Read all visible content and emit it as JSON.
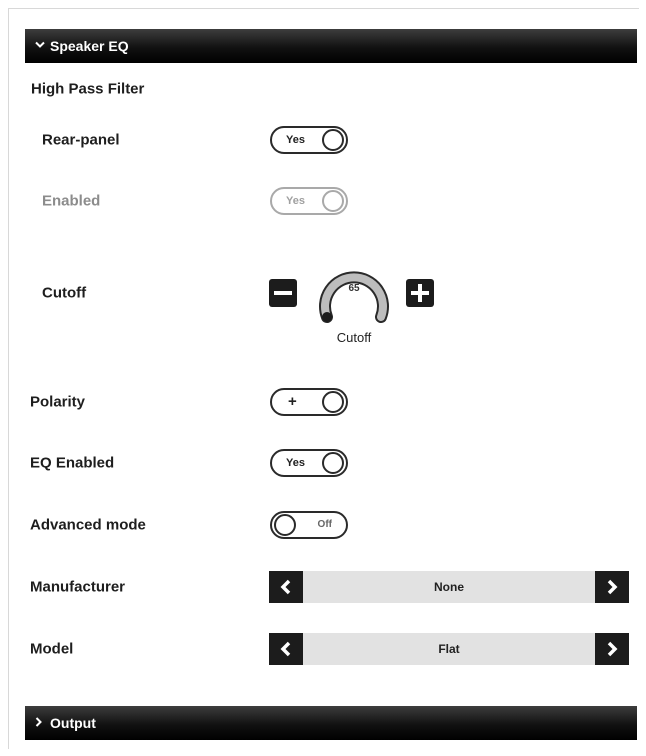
{
  "speaker_eq": {
    "header": "Speaker EQ",
    "expanded": true,
    "high_pass_filter": {
      "title": "High Pass Filter",
      "rear_panel": {
        "label": "Rear-panel",
        "value": "Yes",
        "state": "on"
      },
      "enabled": {
        "label": "Enabled",
        "value": "Yes",
        "state": "on",
        "disabled": true
      },
      "cutoff": {
        "label": "Cutoff",
        "value": "65",
        "caption": "Cutoff",
        "decrement": "minus-icon",
        "increment": "plus-icon"
      }
    },
    "polarity": {
      "label": "Polarity",
      "value": "+",
      "state": "on"
    },
    "eq_enabled": {
      "label": "EQ Enabled",
      "value": "Yes",
      "state": "on"
    },
    "advanced_mode": {
      "label": "Advanced mode",
      "value": "Off",
      "state": "off"
    },
    "manufacturer": {
      "label": "Manufacturer",
      "value": "None",
      "prev_icon": "chevron-left-icon",
      "next_icon": "chevron-right-icon"
    },
    "model": {
      "label": "Model",
      "value": "Flat",
      "prev_icon": "chevron-left-icon",
      "next_icon": "chevron-right-icon"
    }
  },
  "output": {
    "header": "Output",
    "expanded": false
  },
  "colors": {
    "header_bg": "#000000",
    "control_dark": "#1c1c1c",
    "selector_bg": "#e2e2e2",
    "disabled": "#a9a9a9"
  }
}
